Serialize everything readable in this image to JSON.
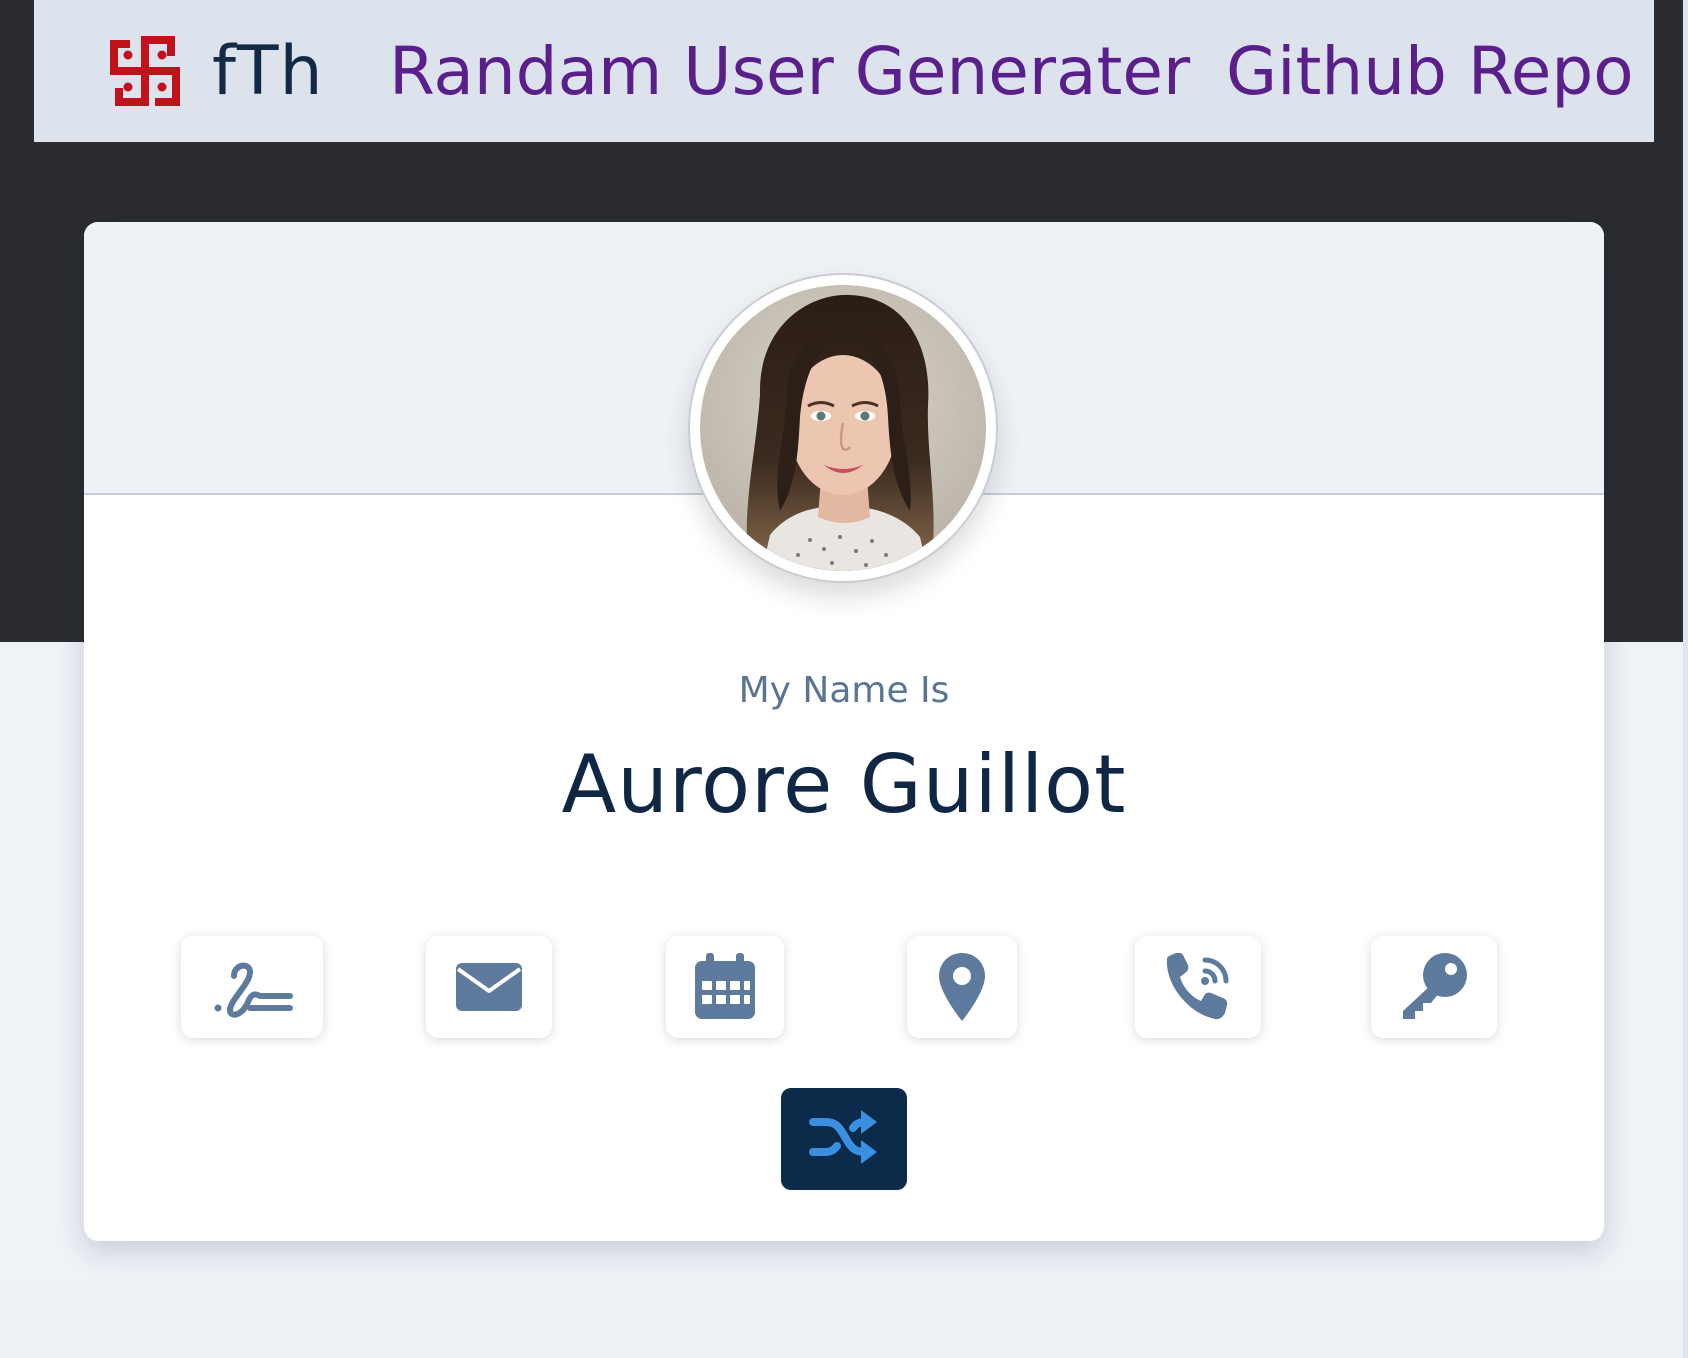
{
  "navbar": {
    "brand": "fTh",
    "links": [
      {
        "label": "Randam User Generater"
      },
      {
        "label": "Github Repo"
      }
    ]
  },
  "card": {
    "label": "My Name Is",
    "value": "Aurore Guillot",
    "info_buttons": [
      {
        "icon": "signature-icon",
        "active": true
      },
      {
        "icon": "envelope-icon"
      },
      {
        "icon": "calendar-icon"
      },
      {
        "icon": "map-marker-icon"
      },
      {
        "icon": "phone-volume-icon"
      },
      {
        "icon": "key-icon"
      }
    ],
    "shuffle_icon": "shuffle-icon"
  },
  "colors": {
    "navbar_bg": "#dce3ed",
    "link": "#5a1f8a",
    "brand_text": "#132a47",
    "logo": "#c0121a",
    "icon": "#5e7a9c",
    "shuffle_bg": "#0c2a4a",
    "shuffle_icon": "#3a8fe0",
    "dark_bg": "#2a2c31",
    "page_bg": "#eff3f8"
  }
}
